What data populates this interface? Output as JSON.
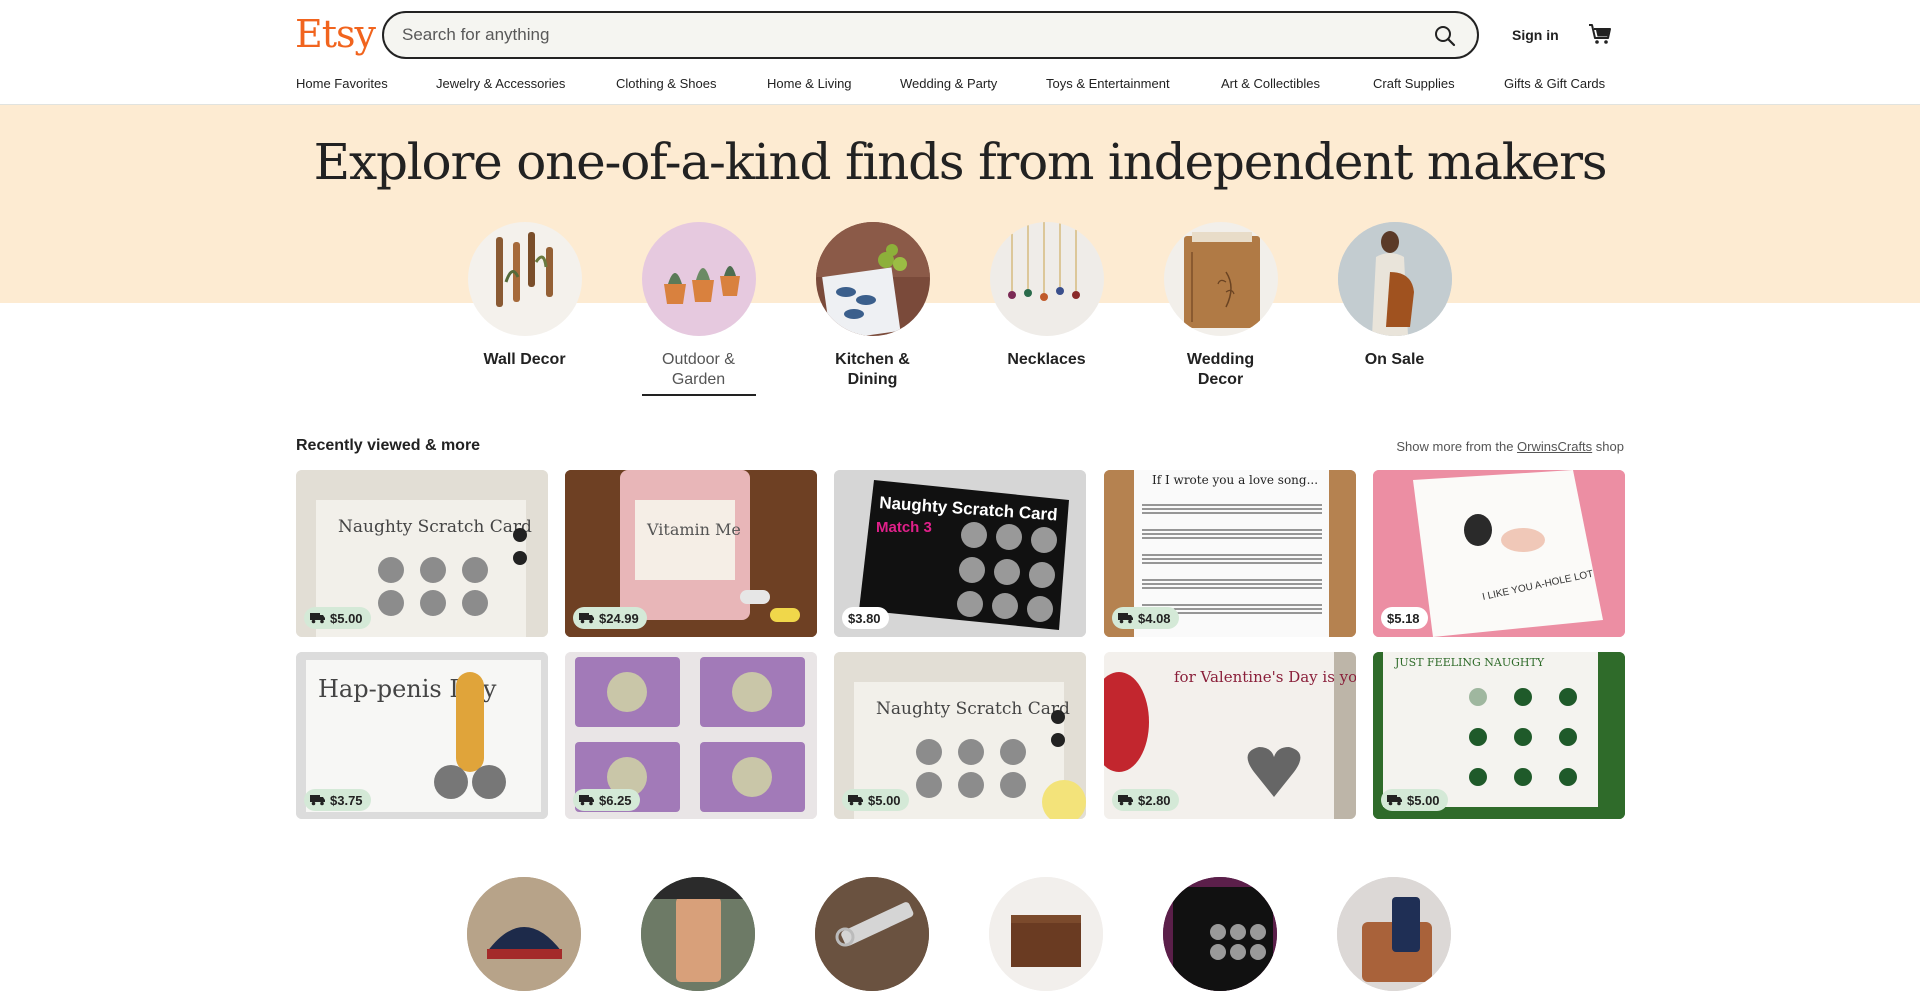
{
  "header": {
    "logo": "Etsy",
    "search_placeholder": "Search for anything",
    "sign_in": "Sign in",
    "nav": [
      "Home Favorites",
      "Jewelry & Accessories",
      "Clothing & Shoes",
      "Home & Living",
      "Wedding & Party",
      "Toys & Entertainment",
      "Art & Collectibles",
      "Craft Supplies",
      "Gifts & Gift Cards"
    ]
  },
  "hero": {
    "title": "Explore one-of-a-kind finds from independent makers",
    "categories": [
      {
        "label": "Wall Decor",
        "active": false
      },
      {
        "label": "Outdoor & Garden",
        "active": true
      },
      {
        "label": "Kitchen & Dining",
        "active": false
      },
      {
        "label": "Necklaces",
        "active": false
      },
      {
        "label": "Wedding Decor",
        "active": false
      },
      {
        "label": "On Sale",
        "active": false
      }
    ]
  },
  "recently_viewed": {
    "title": "Recently viewed & more",
    "show_more_prefix": "Show more from the",
    "shop_name": "OrwinsCrafts",
    "show_more_suffix": "shop",
    "items": [
      {
        "price": "$5.00",
        "free_shipping": true,
        "image_text": "Naughty Scratch Card"
      },
      {
        "price": "$24.99",
        "free_shipping": true,
        "image_text": "Vitamin Me"
      },
      {
        "price": "$3.80",
        "free_shipping": false,
        "image_text": "Naughty Scratch Card"
      },
      {
        "price": "$4.08",
        "free_shipping": true,
        "image_text": "If I wrote you a love song..."
      },
      {
        "price": "$5.18",
        "free_shipping": false,
        "image_text": "I LIKE YOU A-HOLE LOT"
      },
      {
        "price": "$3.75",
        "free_shipping": true,
        "image_text": "Hap-penis Day"
      },
      {
        "price": "$6.25",
        "free_shipping": true,
        "image_text": ""
      },
      {
        "price": "$5.00",
        "free_shipping": true,
        "image_text": "Naughty Scratch Card"
      },
      {
        "price": "$2.80",
        "free_shipping": true,
        "image_text": "for Valentine's Day is you..."
      },
      {
        "price": "$5.00",
        "free_shipping": true,
        "image_text": "JUST FEELING NAUGHTY"
      }
    ]
  },
  "colors": {
    "brand": "#f1641e",
    "hero_bg": "#fdebd2",
    "free_shipping_badge": "#d4e9d7"
  }
}
